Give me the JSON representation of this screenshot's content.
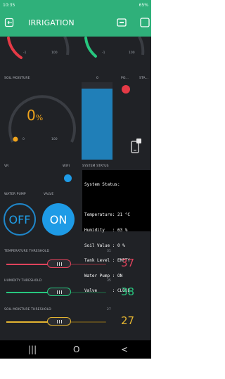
{
  "status_bar": {
    "time": "10:35",
    "right": "65%"
  },
  "app": {
    "title": "IRRIGATION"
  },
  "gauges_top": {
    "left_min": "-1",
    "left_max": "100",
    "right_min": "-1",
    "right_max": "100"
  },
  "soil_moisture": {
    "label": "SOIL MOISTURE",
    "value": "0",
    "unit": "%",
    "min": "0",
    "max": "100",
    "bar_value_label": "0",
    "power_label": "PO...",
    "status_label": "STA...",
    "bar_level": 0.92
  },
  "labels": {
    "vr": "VR",
    "wifi": "WIFI",
    "system_status": "SYSTEM STATUS",
    "water_pump": "WATER PUMP",
    "valve": "VALVE"
  },
  "terminal": {
    "lines": [
      "System Status:",
      "",
      "Temperature: 21 °C",
      "Humidity   : 63 %",
      "Soil Value : 0 %",
      "Tank Level : EMPTY",
      "Water Pump : ON",
      "Valve      : CLOSE"
    ]
  },
  "buttons": {
    "off": "OFF",
    "on": "ON"
  },
  "thresholds": [
    {
      "label": "TEMPERATURE THRESHOLD",
      "max_label": "31",
      "value": "37",
      "color": "#e0435c",
      "fill": 0.53
    },
    {
      "label": "HUMIDITY THRESHOLD",
      "max_label": "35",
      "value": "38",
      "color": "#27c77f",
      "fill": 0.53
    },
    {
      "label": "SOIL MOISTURE THRESHOLD",
      "max_label": "27",
      "value": "27",
      "color": "#e3b431",
      "fill": 0.53
    }
  ],
  "nav": {
    "recent": "|||",
    "home": "O",
    "back": "<"
  },
  "colors": {
    "accent_green": "#2fb07a",
    "gauge_orange": "#f2a51c",
    "bar_blue": "#1e9be6",
    "led_red": "#e53a46"
  }
}
